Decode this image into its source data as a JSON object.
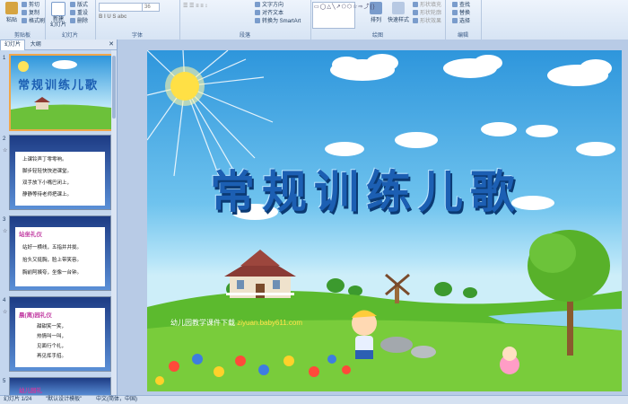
{
  "ribbon": {
    "groups": {
      "clipboard": "剪贴板",
      "slides": "幻灯片",
      "font": "字体",
      "paragraph": "段落",
      "drawing": "绘图",
      "editing": "编辑"
    },
    "clipboard": {
      "paste": "粘贴",
      "cut": "剪切",
      "copy": "复制",
      "format_painter": "格式刷"
    },
    "slides": {
      "new_slide": "新建\n幻灯片",
      "layout": "版式",
      "reset": "重设",
      "delete": "删除"
    },
    "font": {
      "font_name": "",
      "font_size": "36"
    },
    "paragraph": {
      "text_direction": "文字方向",
      "align_text": "对齐文本",
      "smartart": "转换为 SmartArt"
    },
    "drawing": {
      "arrange": "排列",
      "quick_styles": "快速样式",
      "shape_fill": "形状填充",
      "shape_outline": "形状轮廓",
      "shape_effects": "形状效果"
    },
    "editing": {
      "find": "查找",
      "replace": "替换",
      "select": "选择"
    }
  },
  "outline": {
    "tabs": [
      "幻灯片",
      "大纲"
    ],
    "close_icon": "close-icon",
    "thumbnails": [
      {
        "number": "1",
        "title": "常规训练儿歌"
      },
      {
        "number": "2",
        "lines": [
          "上课铃声丁零零响。",
          "脚步轻轻快快进课堂。",
          "双手放下小嘴巴闭上，",
          "静静等待老师把课上。"
        ]
      },
      {
        "number": "3",
        "heading": "站坐礼仪",
        "lines": [
          "站好一横线，五指并并拢。",
          "抬头又挺胸，脸上带笑容。",
          "胸前阿姨夸，坐像一台钟。"
        ]
      },
      {
        "number": "4",
        "heading": "晨(离)园礼仪",
        "lines": [
          "甜甜笑一笑，",
          "热情叫一叫，",
          "见面行个礼，",
          "再见挥手招。"
        ]
      },
      {
        "number": "5",
        "heading": "幼儿园礼"
      }
    ]
  },
  "slide": {
    "title": "常规训练儿歌",
    "caption_prefix": "幼儿园教学课件下载",
    "caption_url": "ziyuan.baby611.com"
  },
  "status": {
    "slide_info": "幻灯片 1/24",
    "theme": "\"默认设计模板\"",
    "language": "中文(简体，中国)"
  },
  "colors": {
    "ribbon_bg": "#dce8f6",
    "selected_border": "#f0a64b",
    "title_blue": "#1c5fb3"
  }
}
